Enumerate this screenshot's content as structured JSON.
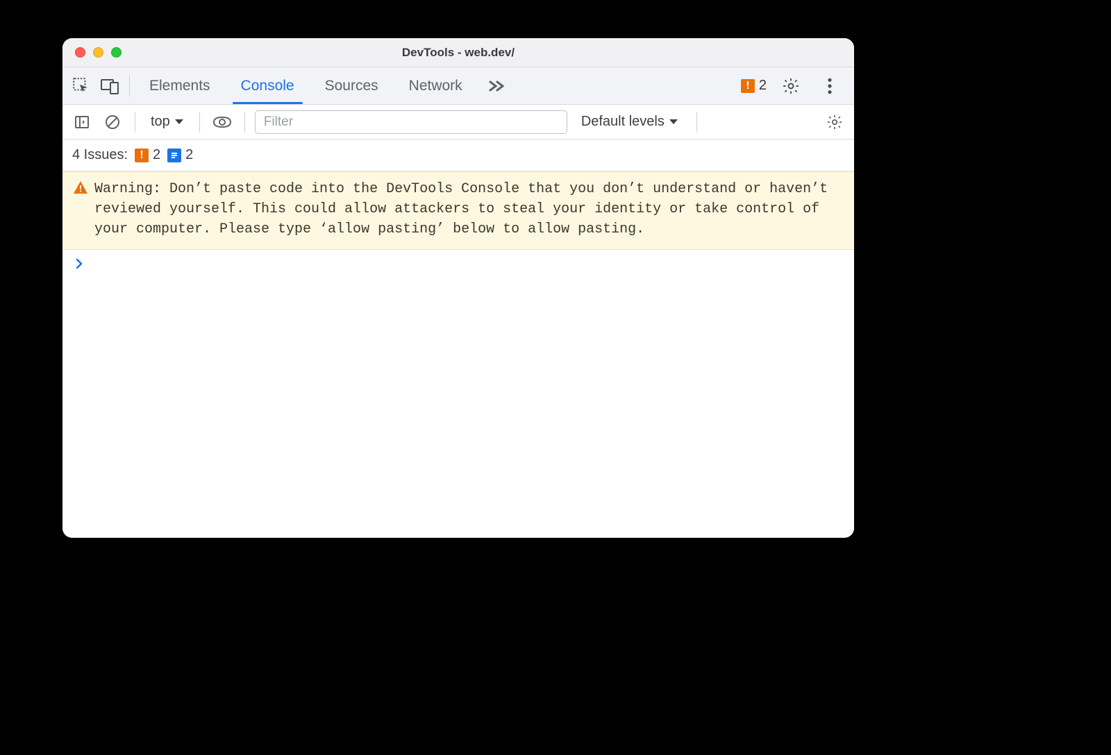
{
  "window": {
    "title": "DevTools - web.dev/"
  },
  "tabs": {
    "elements": "Elements",
    "console": "Console",
    "sources": "Sources",
    "network": "Network"
  },
  "topbar": {
    "issue_count": "2"
  },
  "toolbar": {
    "context": "top",
    "filter_placeholder": "Filter",
    "levels": "Default levels"
  },
  "issues": {
    "label": "4 Issues:",
    "orange_count": "2",
    "blue_count": "2"
  },
  "console": {
    "warning": "Warning: Don’t paste code into the DevTools Console that you don’t understand or haven’t reviewed yourself. This could allow attackers to steal your identity or take control of your computer. Please type ‘allow pasting’ below to allow pasting."
  }
}
